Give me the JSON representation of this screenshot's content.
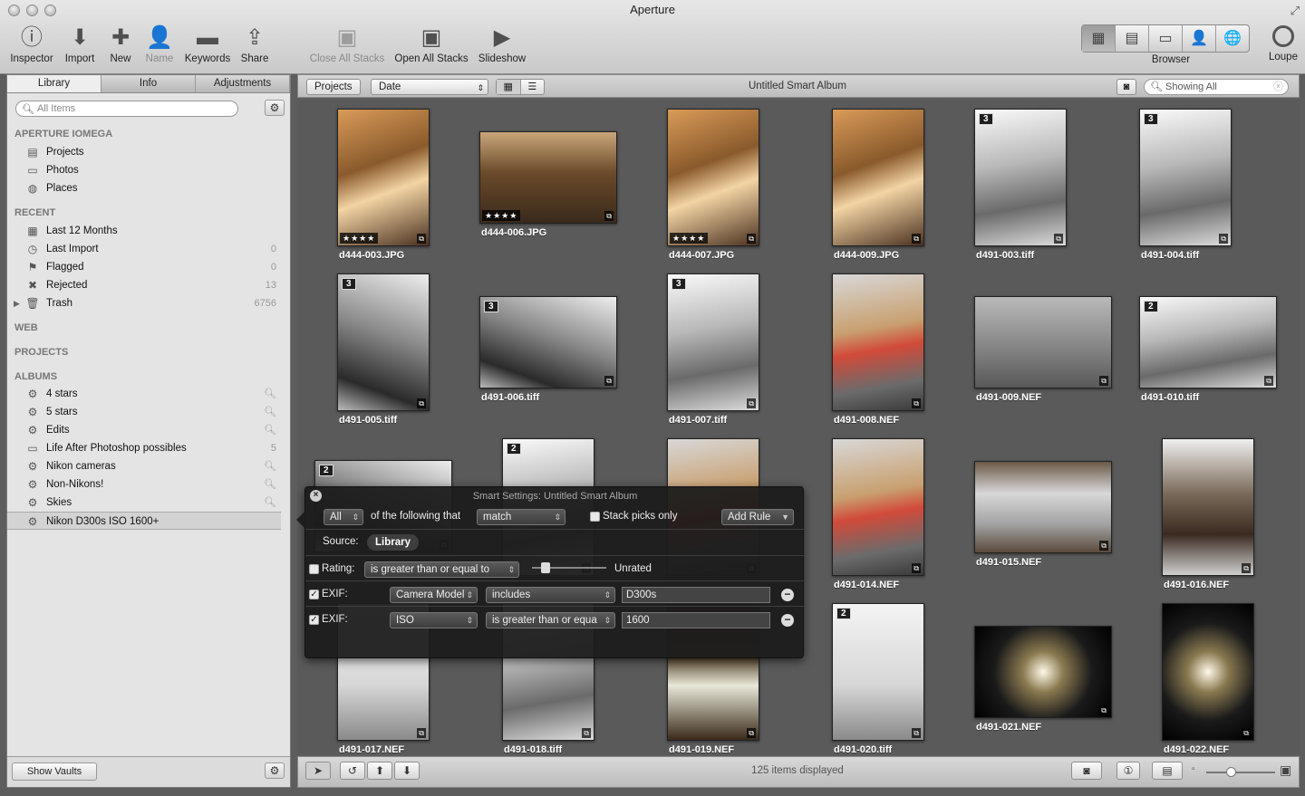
{
  "app": {
    "title": "Aperture"
  },
  "toolbar": {
    "inspector": "Inspector",
    "import": "Import",
    "new": "New",
    "name": "Name",
    "keywords": "Keywords",
    "share": "Share",
    "close_stacks": "Close All Stacks",
    "open_stacks": "Open All Stacks",
    "slideshow": "Slideshow",
    "browser": "Browser",
    "loupe": "Loupe"
  },
  "sidebar": {
    "tabs": [
      "Library",
      "Info",
      "Adjustments"
    ],
    "search_placeholder": "All Items",
    "sections": {
      "library_name": "APERTURE IOMEGA",
      "recent": "RECENT",
      "web": "WEB",
      "projects": "PROJECTS",
      "albums": "ALBUMS"
    },
    "library_items": [
      {
        "label": "Projects",
        "icon": "projects-icon"
      },
      {
        "label": "Photos",
        "icon": "photos-icon"
      },
      {
        "label": "Places",
        "icon": "places-icon"
      }
    ],
    "recent_items": [
      {
        "label": "Last 12 Months",
        "count": ""
      },
      {
        "label": "Last Import",
        "count": "0"
      },
      {
        "label": "Flagged",
        "count": "0"
      },
      {
        "label": "Rejected",
        "count": "13"
      },
      {
        "label": "Trash",
        "count": "6756"
      }
    ],
    "album_items": [
      {
        "label": "4 stars",
        "count": ""
      },
      {
        "label": "5 stars",
        "count": ""
      },
      {
        "label": "Edits",
        "count": ""
      },
      {
        "label": "Life After Photoshop possibles",
        "count": "5"
      },
      {
        "label": "Nikon cameras",
        "count": ""
      },
      {
        "label": "Non-Nikons!",
        "count": ""
      },
      {
        "label": "Skies",
        "count": ""
      },
      {
        "label": "Nikon D300s ISO 1600+",
        "count": ""
      }
    ],
    "show_vaults": "Show Vaults"
  },
  "browser_header": {
    "projects_button": "Projects",
    "sort": "Date",
    "album_title": "Untitled Smart Album",
    "filter": "Showing All"
  },
  "thumbnails": [
    {
      "name": "d444-003.JPG",
      "stars": "★★★★",
      "badge": ""
    },
    {
      "name": "d444-006.JPG",
      "stars": "★★★★",
      "badge": ""
    },
    {
      "name": "d444-007.JPG",
      "stars": "★★★★",
      "badge": ""
    },
    {
      "name": "d444-009.JPG",
      "stars": "",
      "badge": ""
    },
    {
      "name": "d491-003.tiff",
      "stars": "",
      "badge": "3"
    },
    {
      "name": "d491-004.tiff",
      "stars": "",
      "badge": "3"
    },
    {
      "name": "d491-005.tiff",
      "stars": "",
      "badge": "3"
    },
    {
      "name": "d491-006.tiff",
      "stars": "",
      "badge": "3"
    },
    {
      "name": "d491-007.tiff",
      "stars": "",
      "badge": "3"
    },
    {
      "name": "d491-008.NEF",
      "stars": "",
      "badge": ""
    },
    {
      "name": "d491-009.NEF",
      "stars": "",
      "badge": ""
    },
    {
      "name": "d491-010.tiff",
      "stars": "",
      "badge": "2"
    },
    {
      "name": "",
      "stars": "",
      "badge": "2"
    },
    {
      "name": "",
      "stars": "",
      "badge": "2"
    },
    {
      "name": "",
      "stars": "",
      "badge": ""
    },
    {
      "name": "d491-014.NEF",
      "stars": "",
      "badge": ""
    },
    {
      "name": "d491-015.NEF",
      "stars": "",
      "badge": ""
    },
    {
      "name": "d491-016.NEF",
      "stars": "",
      "badge": ""
    },
    {
      "name": "d491-017.NEF",
      "stars": "",
      "badge": ""
    },
    {
      "name": "d491-018.tiff",
      "stars": "",
      "badge": ""
    },
    {
      "name": "d491-019.NEF",
      "stars": "",
      "badge": ""
    },
    {
      "name": "d491-020.tiff",
      "stars": "",
      "badge": "2"
    },
    {
      "name": "d491-021.NEF",
      "stars": "",
      "badge": ""
    },
    {
      "name": "d491-022.NEF",
      "stars": "",
      "badge": ""
    }
  ],
  "status": {
    "count": "125 items displayed"
  },
  "smart_settings": {
    "title": "Smart Settings: Untitled Smart Album",
    "match_scope": "All",
    "of_following": "of the following that",
    "match_mode": "match",
    "stack_picks": "Stack picks only",
    "add_rule": "Add Rule",
    "source_label": "Source:",
    "source_value": "Library",
    "rating": {
      "label": "Rating:",
      "op": "is greater than or equal to",
      "value": "Unrated",
      "checked": false
    },
    "exif1": {
      "label": "EXIF:",
      "field": "Camera Model",
      "op": "includes",
      "value": "D300s",
      "checked": true
    },
    "exif2": {
      "label": "EXIF:",
      "field": "ISO",
      "op": "is greater than or equa",
      "value": "1600",
      "checked": true
    }
  },
  "colors": {
    "accent_selection": "#d3d3d3",
    "hud": "#1c1c1c",
    "grid_bg": "#5a5a5a"
  }
}
